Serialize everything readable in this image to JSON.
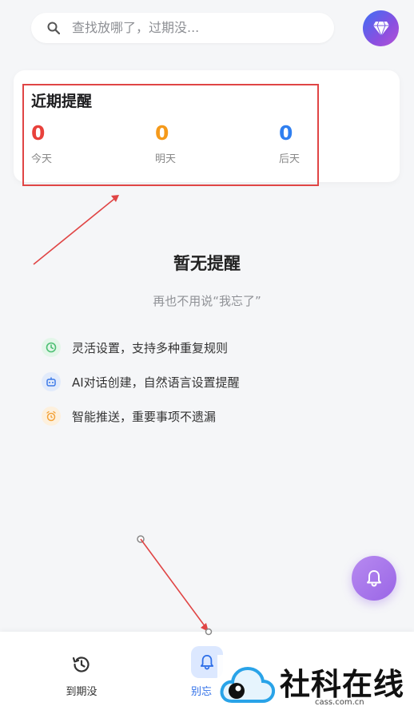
{
  "search": {
    "placeholder": "查找放哪了，过期没..."
  },
  "icons": {
    "search": "search-icon",
    "vip": "diamond-icon",
    "clock": "clock-icon",
    "robot": "robot-icon",
    "alarm": "alarm-icon",
    "bell": "bell-icon",
    "history": "history-icon"
  },
  "reminders": {
    "title": "近期提醒",
    "today": {
      "value": "0",
      "label": "今天",
      "color": "#e8413b"
    },
    "tomorrow": {
      "value": "0",
      "label": "明天",
      "color": "#f59a1b"
    },
    "day_after": {
      "value": "0",
      "label": "后天",
      "color": "#2f7ff0"
    }
  },
  "empty": {
    "title": "暂无提醒",
    "subtitle": "再也不用说“我忘了”"
  },
  "features": [
    {
      "text": "灵活设置，支持多种重复规则",
      "color": "#4cbf73",
      "bg": "#e3f6e9"
    },
    {
      "text": "AI对话创建，自然语言设置提醒",
      "color": "#3d7ae8",
      "bg": "#e2ebfb"
    },
    {
      "text": "智能推送，重要事项不遗漏",
      "color": "#f3a33a",
      "bg": "#fdf0dd"
    }
  ],
  "nav": {
    "expired_label": "到期没",
    "forget_label": "别忘"
  },
  "watermark": {
    "text": "社科在线",
    "sub": "cass.com.cn"
  },
  "colors": {
    "annotation": "#e04545",
    "accent": "#9a66e6"
  }
}
